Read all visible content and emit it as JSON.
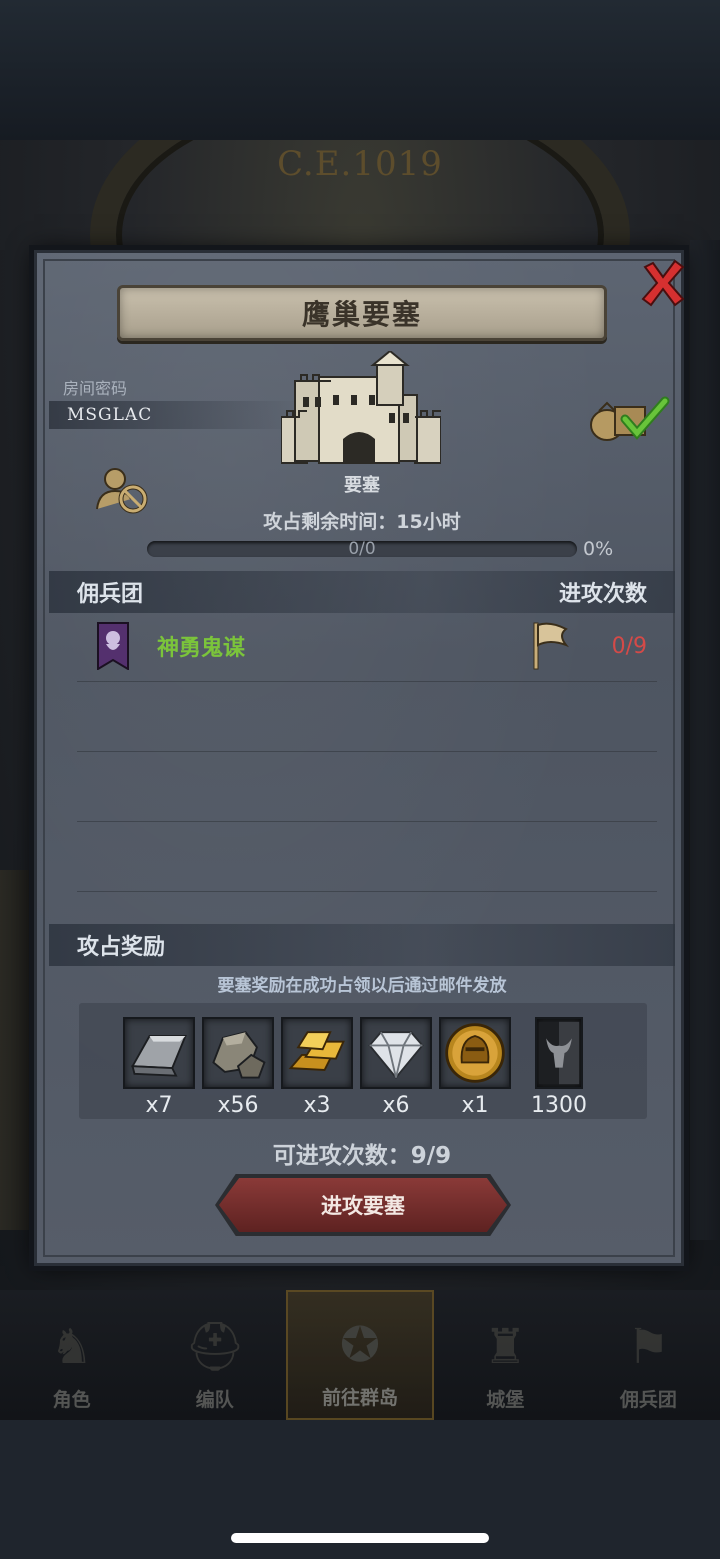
{
  "background": {
    "date": "C.E.1019"
  },
  "dialog": {
    "title": "鹰巢要塞",
    "room_label": "房间密码",
    "room_code": "MSGLAC",
    "fortress_name": "要塞",
    "remaining_time": "攻占剩余时间：15小时",
    "progress": {
      "text": "0/0",
      "percent_text": "0%",
      "fraction": 0
    },
    "mercenary_section": {
      "title": "佣兵团",
      "attacks_header": "进攻次数"
    },
    "mercenaries": [
      {
        "name": "神勇鬼谋",
        "attacks": "0/9"
      }
    ],
    "reward_section": {
      "title": "攻占奖励",
      "note": "要塞奖励在成功占领以后通过邮件发放",
      "items": [
        {
          "icon": "iron-ingot-icon",
          "qty": "x7"
        },
        {
          "icon": "stone-ore-icon",
          "qty": "x56"
        },
        {
          "icon": "gold-bars-icon",
          "qty": "x3"
        },
        {
          "icon": "diamond-icon",
          "qty": "x6"
        },
        {
          "icon": "gold-helmet-coin-icon",
          "qty": "x1"
        },
        {
          "icon": "bull-banner-icon",
          "qty": "1300"
        }
      ]
    },
    "attempts": "可进攻次数：9/9",
    "attack_button": "进攻要塞"
  },
  "bottom_nav": [
    {
      "label": "角色",
      "icon": "knight-icon"
    },
    {
      "label": "编队",
      "icon": "helmet-icon"
    },
    {
      "label": "前往群岛",
      "icon": "compass-icon",
      "active": true
    },
    {
      "label": "城堡",
      "icon": "castle-icon"
    },
    {
      "label": "佣兵团",
      "icon": "flag-icon"
    }
  ],
  "colors": {
    "merc_name": "#7bc43b",
    "attack_count": "#d44a48",
    "button": "#8a3a38",
    "close": "#d63030"
  }
}
